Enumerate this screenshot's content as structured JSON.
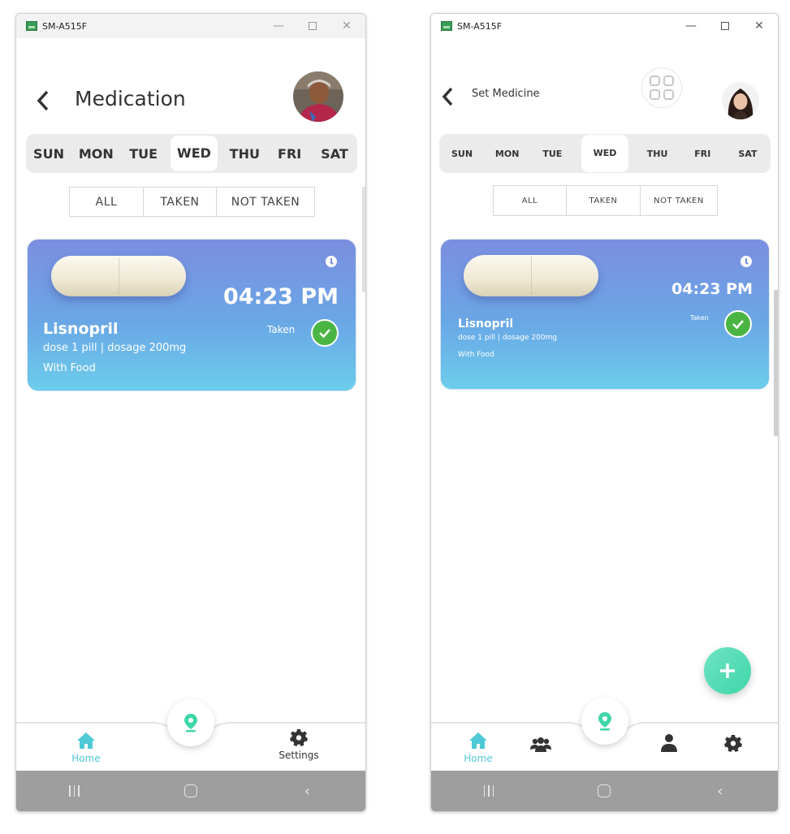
{
  "window1": {
    "title": "SM-A515F",
    "header": {
      "title": "Medication"
    },
    "days": [
      "SUN",
      "MON",
      "TUE",
      "WED",
      "THU",
      "FRI",
      "SAT"
    ],
    "selected_day": "WED",
    "filters": [
      "ALL",
      "TAKEN",
      "NOT TAKEN"
    ],
    "card": {
      "time": "04:23 PM",
      "name": "Lisnopril",
      "info": "dose 1 pill | dosage 200mg",
      "food": "With Food",
      "status": "Taken"
    },
    "nav": {
      "home": "Home",
      "settings": "Settings"
    }
  },
  "window2": {
    "title": "SM-A515F",
    "header": {
      "title": "Set Medicine"
    },
    "days": [
      "SUN",
      "MON",
      "TUE",
      "WED",
      "THU",
      "FRI",
      "SAT"
    ],
    "selected_day": "WED",
    "filters": [
      "ALL",
      "TAKEN",
      "NOT TAKEN"
    ],
    "card": {
      "time": "04:23 PM",
      "name": "Lisnopril",
      "info": "dose 1 pill | dosage 200mg",
      "food": "With Food",
      "status": "Taken"
    },
    "nav": {
      "home": "Home"
    }
  },
  "colors": {
    "accent": "#3fd6a8",
    "card_top": "#7b8ee0",
    "card_bottom": "#6ccdeb",
    "taken_check": "#4bb543",
    "nav_active": "#4ec9d6"
  },
  "icons": {
    "back": "chevron-left-icon",
    "clock": "clock-icon",
    "check": "check-icon",
    "home": "home-icon",
    "settings": "gear-icon",
    "location": "location-pin-icon",
    "group": "users-icon",
    "person": "user-icon",
    "grid": "grid-icon",
    "add": "plus-icon"
  }
}
